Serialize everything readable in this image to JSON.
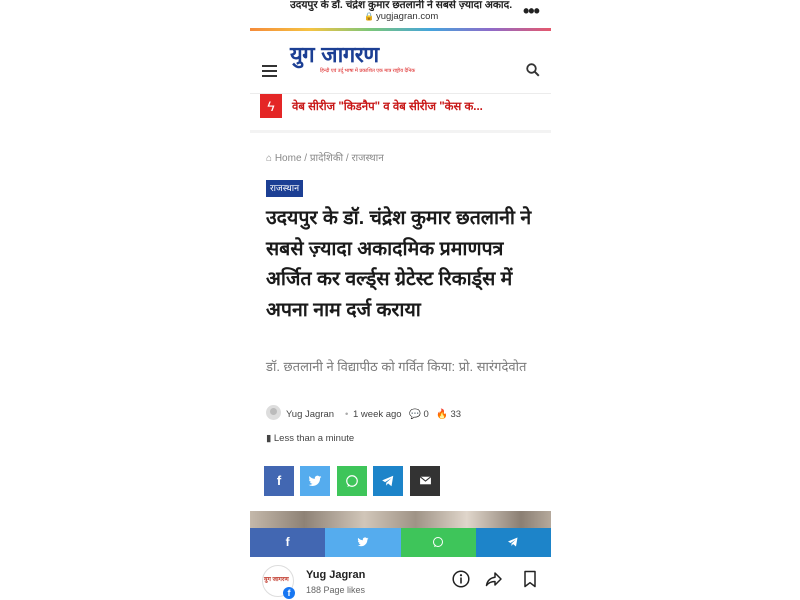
{
  "browser": {
    "title": "उदयपुर के डॉ. चंद्रेश कुमार छतलानी ने सबसे ज़्यादा अकाद...",
    "url": "yugjagran.com"
  },
  "header": {
    "logo_text": "युग जागरण",
    "logo_tagline": "हिन्दी एवं उर्दू भाषा में प्रकाशित एक मात्र राष्ट्रीय दैनिक"
  },
  "breaking": {
    "text": "वेब सीरीज \"किडनैप\" व वेब सीरीज \"केस क..."
  },
  "breadcrumb": {
    "home": "Home",
    "sep": "/",
    "section": "प्रादेशिकी",
    "subsection": "राजस्थान"
  },
  "article": {
    "category": "राजस्थान",
    "title": "उदयपुर के डॉ. चंद्रेश कुमार छतलानी ने सबसे ज़्यादा अकादमिक प्रमाणपत्र अर्जित कर वर्ल्ड्स ग्रेटेस्ट रिकार्ड्स में अपना नाम दर्ज कराया",
    "subtitle": "डॉ. छतलानी ने विद्यापीठ को गर्वित किया: प्रो. सारंगदेवोत",
    "author": "Yug Jagran",
    "time": "1 week ago",
    "comments": "0",
    "views": "33",
    "read_time": "Less than a minute"
  },
  "fb_page": {
    "name": "Yug Jagran",
    "likes": "188 Page likes",
    "avatar_text": "युग जागरण"
  },
  "colors": {
    "brand_blue": "#1c3f94",
    "breaking_red": "#e42626",
    "facebook": "#4267b2",
    "twitter": "#55acee",
    "whatsapp": "#3ec55a",
    "telegram": "#1d84c9",
    "email": "#333333"
  }
}
